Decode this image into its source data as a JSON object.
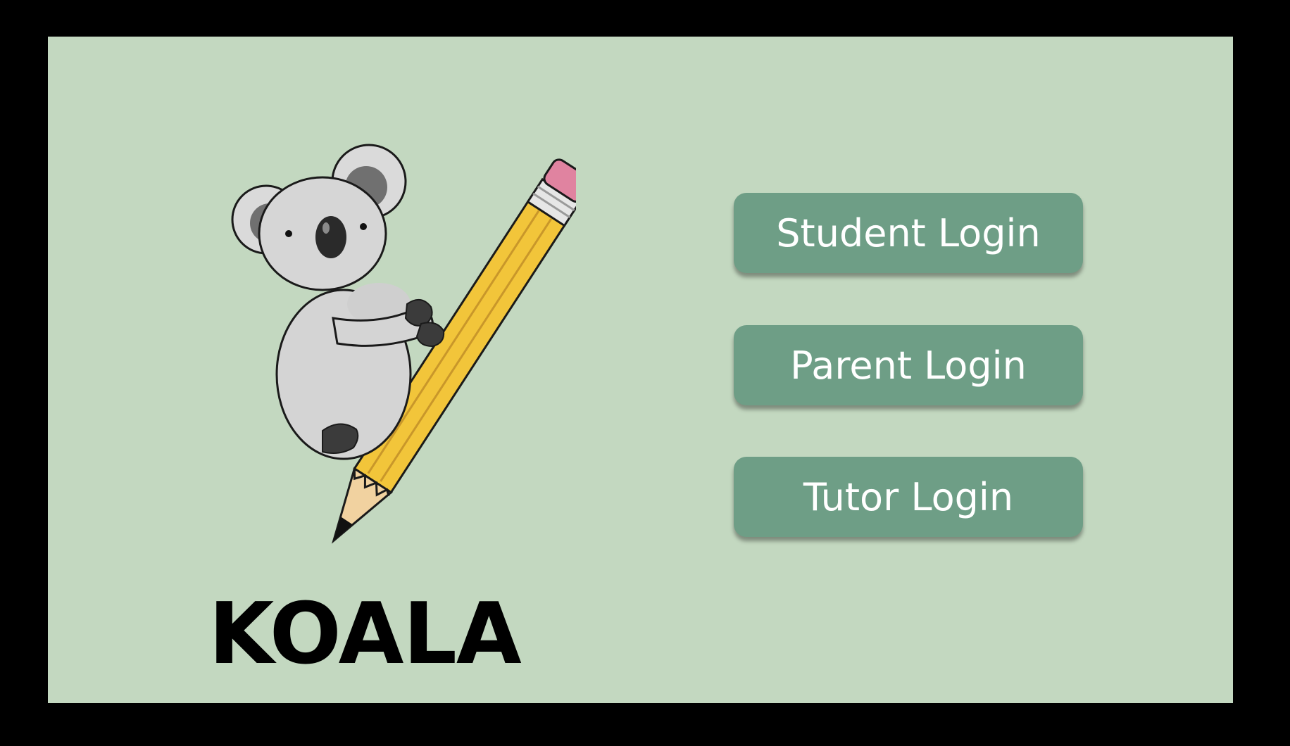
{
  "brand": {
    "name": "KOALA",
    "mascot_icon": "koala-on-pencil-icon"
  },
  "logins": {
    "student_label": "Student Login",
    "parent_label": "Parent Login",
    "tutor_label": "Tutor Login"
  },
  "colors": {
    "background": "#c3d8c0",
    "frame": "#000000",
    "button": "#6e9e86",
    "button_text": "#ffffff"
  }
}
